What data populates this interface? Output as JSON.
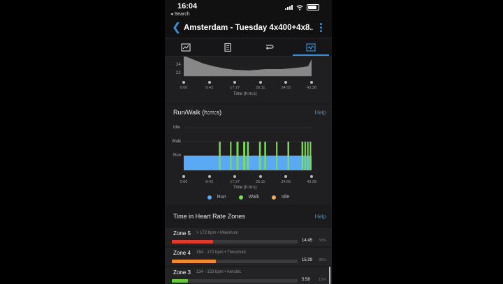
{
  "status_bar": {
    "time": "16:04",
    "back_app": "◂ Search"
  },
  "header": {
    "title": "Amsterdam - Tuesday 4x400+4x8..."
  },
  "tabs": [
    {
      "icon": "chart-overview-icon",
      "active": false
    },
    {
      "icon": "details-document-icon",
      "active": false
    },
    {
      "icon": "laps-loop-icon",
      "active": false
    },
    {
      "icon": "stats-chart-icon",
      "active": true
    }
  ],
  "top_chart": {
    "y_ticks": [
      "24",
      "22"
    ],
    "x_ticks": [
      "0:00",
      "8:43",
      "17:27",
      "26:11",
      "34:55",
      "43:38"
    ],
    "x_label": "Time (h:m:s)"
  },
  "chart_data": {
    "type": "area",
    "title": "Run/Walk (h:m:s)",
    "xlabel": "Time (h:m:s)",
    "ylabel": "",
    "categories_y": [
      "Idle",
      "Walk",
      "Run"
    ],
    "x_ticks": [
      "0:00",
      "8:43",
      "17:27",
      "26:11",
      "34:55",
      "43:38"
    ],
    "x_range_min": [
      0,
      43.63
    ],
    "walk_intervals_min": [
      [
        12.0,
        12.6
      ],
      [
        15.8,
        16.3
      ],
      [
        18.0,
        18.7
      ],
      [
        20.3,
        21.0
      ],
      [
        21.6,
        22.2
      ],
      [
        25.7,
        26.3
      ],
      [
        27.5,
        28.1
      ],
      [
        31.5,
        32.0
      ],
      [
        35.4,
        36.0
      ],
      [
        40.2,
        40.8
      ],
      [
        41.2,
        41.7
      ],
      [
        42.1,
        42.6
      ],
      [
        43.0,
        43.5
      ]
    ],
    "series": [
      {
        "name": "Run",
        "color": "#5aa9f5"
      },
      {
        "name": "Walk",
        "color": "#7cdb5a"
      },
      {
        "name": "Idle",
        "color": "#f2a95b"
      }
    ],
    "help_label": "Help"
  },
  "hr_zones": {
    "title": "Time in Heart Rate Zones",
    "help_label": "Help",
    "zones": [
      {
        "name": "Zone 5",
        "range": "> 172 bpm • Maximum",
        "time": "14:45",
        "pct": "33%",
        "fraction": 0.33,
        "color": "#e03a2f"
      },
      {
        "name": "Zone 4",
        "range": "154 - 172 bpm • Threshold",
        "time": "15:29",
        "pct": "35%",
        "fraction": 0.35,
        "color": "#f08a2e"
      },
      {
        "name": "Zone 3",
        "range": "134 - 153 bpm • Aerobic",
        "time": "5:58",
        "pct": "13%",
        "fraction": 0.13,
        "color": "#6cc63a"
      }
    ]
  }
}
